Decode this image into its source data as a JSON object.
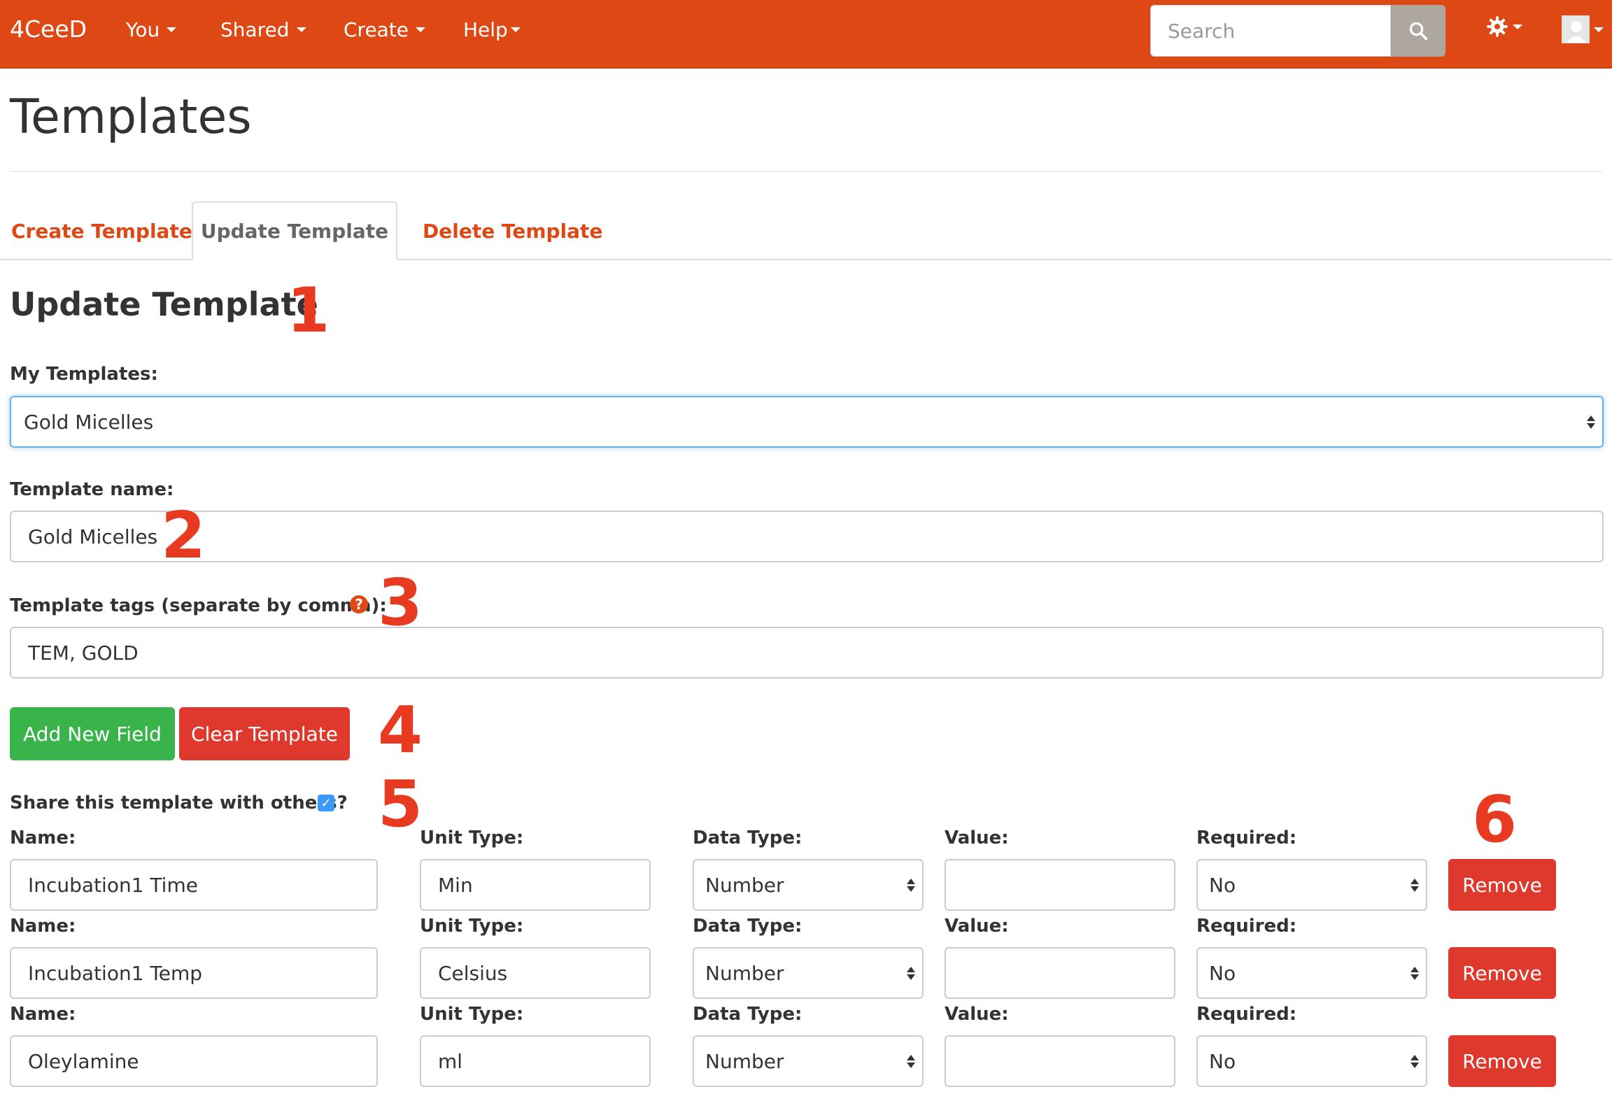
{
  "navbar": {
    "brand": "4CeeD",
    "items": [
      {
        "label": "You"
      },
      {
        "label": "Shared"
      },
      {
        "label": "Create"
      },
      {
        "label": "Help"
      }
    ],
    "search_placeholder": "Search"
  },
  "page": {
    "title": "Templates"
  },
  "tabs": [
    {
      "label": "Create Template",
      "active": false
    },
    {
      "label": "Update Template",
      "active": true
    },
    {
      "label": "Delete Template",
      "active": false
    }
  ],
  "form": {
    "section_title": "Update Template",
    "my_templates_label": "My Templates:",
    "my_templates_value": "Gold Micelles",
    "template_name_label": "Template name:",
    "template_name_value": "Gold Micelles",
    "template_tags_label": "Template tags (separate by comma):",
    "template_tags_value": "TEM, GOLD",
    "add_field_button": "Add New Field",
    "clear_button": "Clear Template",
    "share_label": "Share this template with others?",
    "share_checked": true
  },
  "field_columns": {
    "name": "Name:",
    "unit_type": "Unit Type:",
    "data_type": "Data Type:",
    "value": "Value:",
    "required": "Required:"
  },
  "fields": [
    {
      "name": "Incubation1 Time",
      "unit_type": "Min",
      "data_type": "Number",
      "value": "",
      "required": "No",
      "remove_label": "Remove"
    },
    {
      "name": "Incubation1 Temp",
      "unit_type": "Celsius",
      "data_type": "Number",
      "value": "",
      "required": "No",
      "remove_label": "Remove"
    },
    {
      "name": "Oleylamine",
      "unit_type": "ml",
      "data_type": "Number",
      "value": "",
      "required": "No",
      "remove_label": "Remove"
    }
  ],
  "annotations": [
    "1",
    "2",
    "3",
    "4",
    "5",
    "6"
  ],
  "colors": {
    "navbar": "#dd4814",
    "accent": "#dd4814",
    "green_button": "#38b44a",
    "red_button": "#df382c",
    "annotation": "#e83a21",
    "checkbox": "#3b99fc"
  },
  "icons": {
    "search": "search-icon",
    "settings": "gear-icon",
    "user": "avatar",
    "help": "question-circle-icon"
  }
}
